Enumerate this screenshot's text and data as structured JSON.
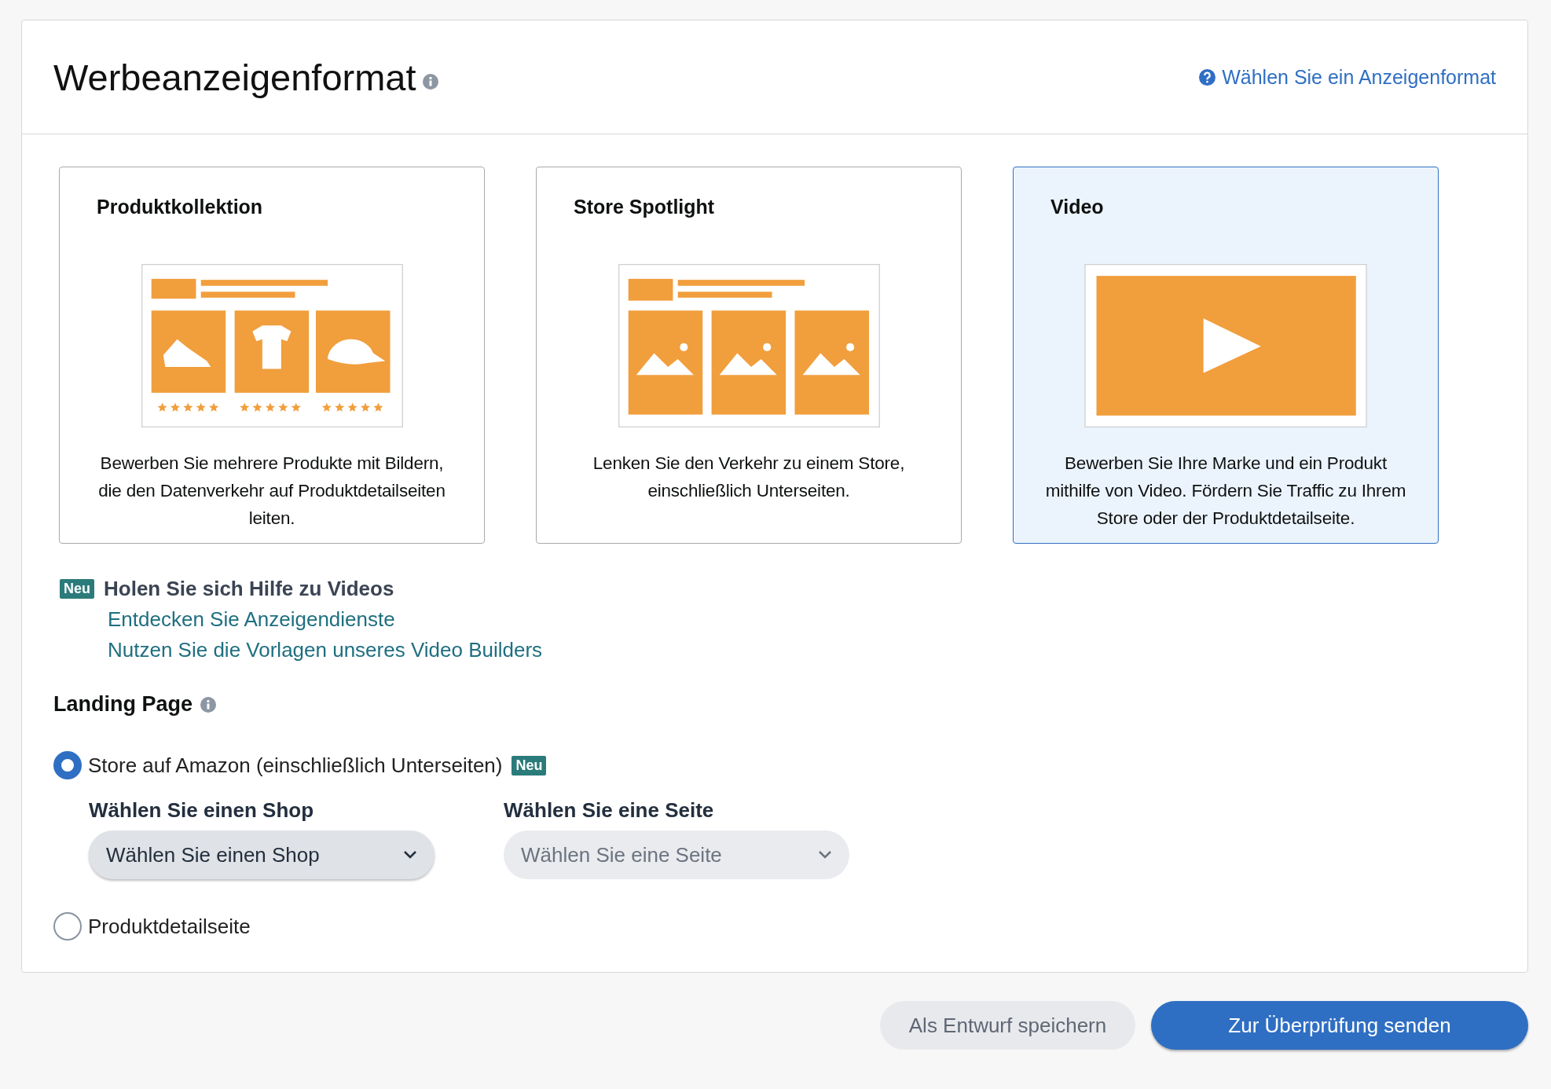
{
  "header": {
    "title": "Werbeanzeigenformat",
    "help_link": "Wählen Sie ein Anzeigenformat"
  },
  "formats": [
    {
      "kind": "collection",
      "title": "Produktkollektion",
      "description": "Bewerben Sie mehrere Produkte mit Bildern, die den Datenverkehr auf Produktdetailseiten leiten.",
      "selected": false
    },
    {
      "kind": "spotlight",
      "title": "Store Spotlight",
      "description": "Lenken Sie den Verkehr zu einem Store, einschließlich Unterseiten.",
      "selected": false
    },
    {
      "kind": "video",
      "title": "Video",
      "description": "Bewerben Sie Ihre Marke und ein Produkt mithilfe von Video. Fördern Sie Traffic zu Ihrem Store oder der Produktdetailseite.",
      "selected": true
    }
  ],
  "help": {
    "badge": "Neu",
    "title": "Holen Sie sich Hilfe zu Videos",
    "links": [
      "Entdecken Sie Anzeigendienste",
      "Nutzen Sie die Vorlagen unseres Video Builders"
    ]
  },
  "landing_page": {
    "title": "Landing Page",
    "options": [
      {
        "label": "Store auf Amazon (einschließlich Unterseiten)",
        "badge": "Neu",
        "selected": true,
        "selects": [
          {
            "label": "Wählen Sie einen Shop",
            "placeholder": "Wählen Sie einen Shop",
            "disabled": false
          },
          {
            "label": "Wählen Sie eine Seite",
            "placeholder": "Wählen Sie eine Seite",
            "disabled": true
          }
        ]
      },
      {
        "label": "Produktdetailseite",
        "selected": false
      }
    ]
  },
  "actions": [
    {
      "label": "Als Entwurf speichern",
      "kind": "secondary"
    },
    {
      "label": "Zur Überprüfung senden",
      "kind": "primary"
    }
  ]
}
